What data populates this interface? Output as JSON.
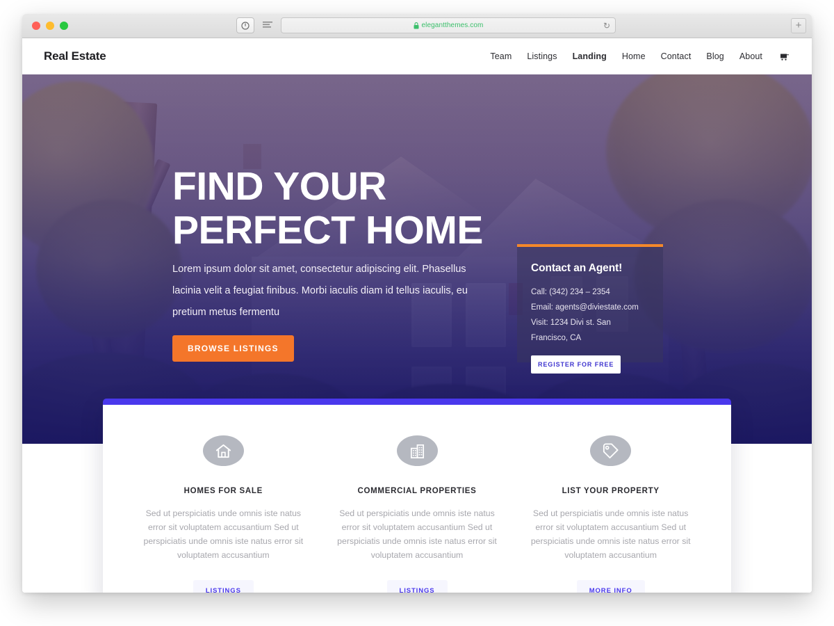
{
  "browser": {
    "url": "elegantthemes.com",
    "lock_icon": "lock-icon",
    "reload_icon": "↻",
    "newtab_label": "+",
    "sidebar_icon": "sidebar-toggle-icon",
    "reader_icon": "reader-view-icon"
  },
  "site": {
    "brand": "Real Estate",
    "nav": [
      {
        "label": "Team",
        "active": false
      },
      {
        "label": "Listings",
        "active": false
      },
      {
        "label": "Landing",
        "active": true
      },
      {
        "label": "Home",
        "active": false
      },
      {
        "label": "Contact",
        "active": false
      },
      {
        "label": "Blog",
        "active": false
      },
      {
        "label": "About",
        "active": false
      }
    ],
    "cart_icon": "shopping-cart-icon"
  },
  "hero": {
    "title_line1": "FIND YOUR",
    "title_line2": "PERFECT HOME",
    "paragraph": "Lorem ipsum dolor sit amet, consectetur adipiscing elit. Phasellus lacinia velit a feugiat finibus. Morbi iaculis diam id tellus iaculis, eu pretium metus fermentu",
    "cta_label": "BROWSE LISTINGS",
    "cta_color": "#f4762a"
  },
  "agent_card": {
    "title": "Contact an Agent!",
    "call": "Call: (342) 234 – 2354",
    "email": "Email: agents@diviestate.com",
    "visit": "Visit: 1234 Divi st. San Francisco, CA",
    "button_label": "REGISTER FOR FREE",
    "accent_color": "#f4882a"
  },
  "features": {
    "accent_color": "#4a38ec",
    "columns": [
      {
        "icon": "home-icon",
        "title": "HOMES FOR SALE",
        "body": "Sed ut perspiciatis unde omnis iste natus error sit voluptatem accusantium Sed ut perspiciatis unde omnis iste natus error sit voluptatem accusantium",
        "button_label": "LISTINGS"
      },
      {
        "icon": "office-buildings-icon",
        "title": "COMMERCIAL PROPERTIES",
        "body": "Sed ut perspiciatis unde omnis iste natus error sit voluptatem accusantium Sed ut perspiciatis unde omnis iste natus error sit voluptatem accusantium",
        "button_label": "LISTINGS"
      },
      {
        "icon": "price-tag-icon",
        "title": "LIST YOUR PROPERTY",
        "body": "Sed ut perspiciatis unde omnis iste natus error sit voluptatem accusantium Sed ut perspiciatis unde omnis iste natus error sit voluptatem accusantium",
        "button_label": "MORE INFO"
      }
    ]
  }
}
